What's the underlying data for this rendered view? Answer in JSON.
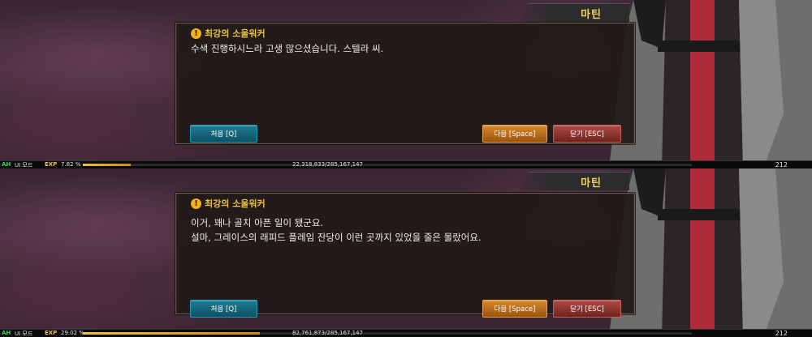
{
  "panels": [
    {
      "npc_name": "마틴",
      "speaker": "최강의 소울워커",
      "lines": [
        "수색 진행하시느라 고생 많으셨습니다. 스텔라 씨."
      ],
      "buttons": {
        "first": "처음 [Q]",
        "next": "다음 [Space]",
        "close": "닫기 [ESC]"
      },
      "status": {
        "ah": "AH",
        "ui_mode": "UI 모드",
        "exp_label": "EXP",
        "exp_percent_text": "7.82 %",
        "exp_fraction": 0.0782,
        "exp_count": "22,318,833/285,167,147",
        "level": "212"
      }
    },
    {
      "npc_name": "마틴",
      "speaker": "최강의 소울워커",
      "lines": [
        "이거, 꽤나 골치 아픈 일이 됐군요.",
        "설마, 그레이스의 래피드 플레임 잔당이 이런 곳까지 있었을 줄은 몰랐어요."
      ],
      "buttons": {
        "first": "처음 [Q]",
        "next": "다음 [Space]",
        "close": "닫기 [ESC]"
      },
      "status": {
        "ah": "AH",
        "ui_mode": "UI 모드",
        "exp_label": "EXP",
        "exp_percent_text": "29.02 %",
        "exp_fraction": 0.2902,
        "exp_count": "82,761,873/285,167,147",
        "level": "212"
      }
    }
  ],
  "colors": {
    "speaker": "#e9c341",
    "npc_name": "#f2d25c",
    "exp_fill": "#f0c23a",
    "btn_first": "#1e7e96",
    "btn_next": "#d88a2a",
    "btn_close": "#b04a44"
  },
  "icons": {
    "warning": "exclamation-circle-icon"
  }
}
